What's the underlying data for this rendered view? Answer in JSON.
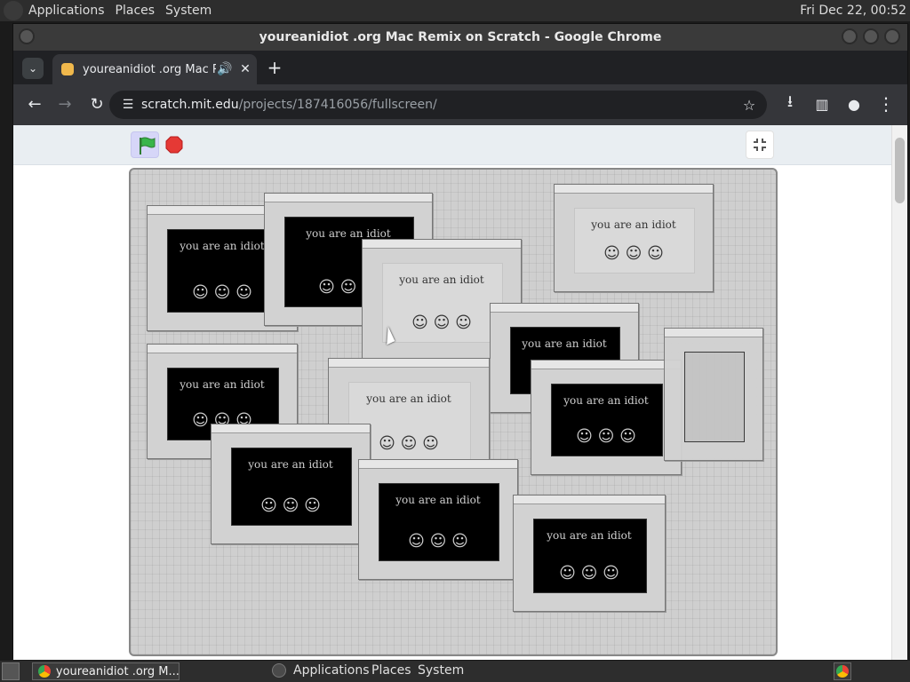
{
  "topbar": {
    "menus": [
      "Applications",
      "Places",
      "System"
    ],
    "clock": "Fri Dec 22, 00:52"
  },
  "browser": {
    "window_title": "youreanidiot .org Mac Remix on Scratch - Google Chrome",
    "tab_title": "youreanidiot .org Mac Rem",
    "url": {
      "host": "scratch.mit.edu",
      "path": "/projects/187416056/fullscreen/"
    }
  },
  "scratch": {
    "icons": {
      "green_flag": "green-flag-icon",
      "stop": "stop-icon",
      "fullscreen_exit": "fullscreen-exit-icon"
    }
  },
  "stage": {
    "phrase": "you are an idiot",
    "faces": "☺ ☺ ☺"
  },
  "taskbar": {
    "task_title": "youreanidiot .org M...",
    "menus": [
      "Applications",
      "Places",
      "System"
    ]
  }
}
